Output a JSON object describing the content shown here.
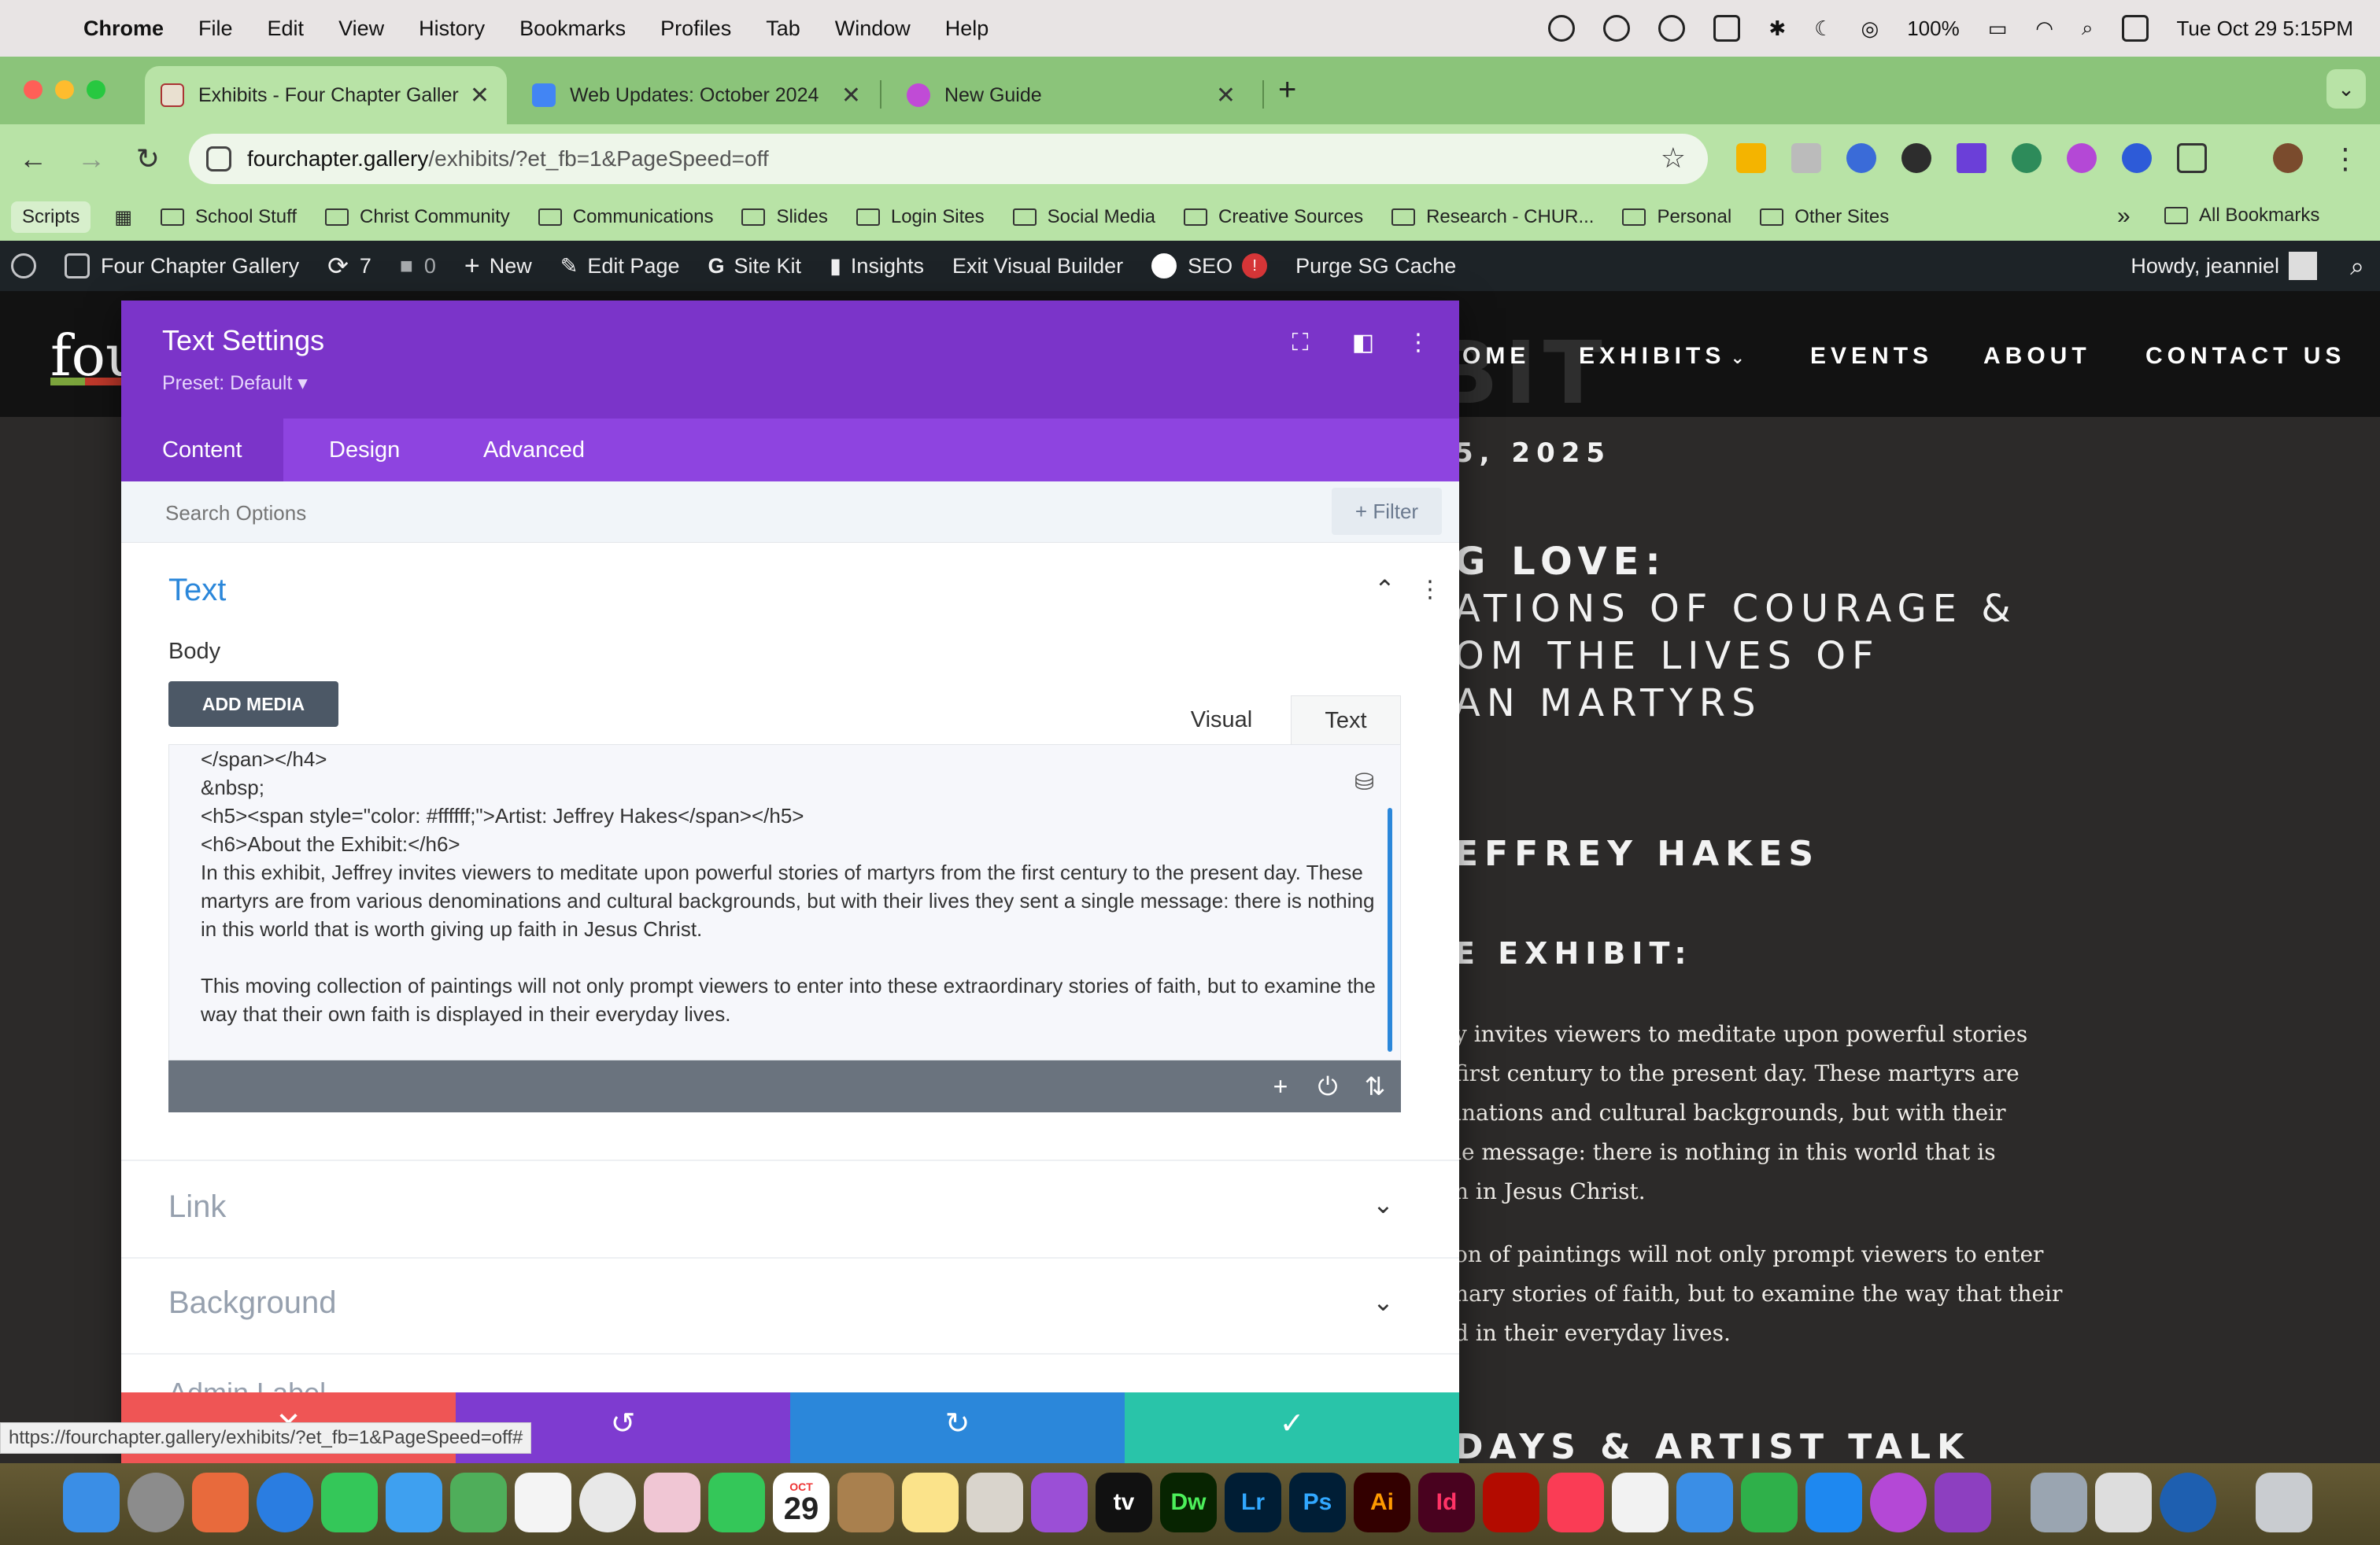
{
  "menubar": {
    "app": "Chrome",
    "items": [
      "File",
      "Edit",
      "View",
      "History",
      "Bookmarks",
      "Profiles",
      "Tab",
      "Window",
      "Help"
    ],
    "battery": "100%",
    "datetime": "Tue Oct 29  5:15PM"
  },
  "tabs": [
    {
      "title": "Exhibits - Four Chapter Galler",
      "active": true
    },
    {
      "title": "Web Updates: October 2024",
      "active": false
    },
    {
      "title": "New Guide",
      "active": false
    }
  ],
  "address": {
    "host": "fourchapter.gallery",
    "path": "/exhibits/?et_fb=1&PageSpeed=off"
  },
  "bookmarks": {
    "scripts": "Scripts",
    "folders": [
      "School Stuff",
      "Christ Community",
      "Communications",
      "Slides",
      "Login Sites",
      "Social Media",
      "Creative Sources",
      "Research - CHUR...",
      "Personal",
      "Other Sites"
    ],
    "more": "»",
    "all": "All Bookmarks"
  },
  "wpbar": {
    "site": "Four Chapter Gallery",
    "updates": "7",
    "comments": "0",
    "new": "New",
    "edit": "Edit Page",
    "sitekit": "Site Kit",
    "insights": "Insights",
    "exit": "Exit Visual Builder",
    "seo": "SEO",
    "seo_badge": "!",
    "purge": "Purge SG Cache",
    "howdy": "Howdy, jeanniel"
  },
  "site": {
    "logo": "fou",
    "nav": [
      "OME",
      "EXHIBITS",
      "EVENTS",
      "ABOUT",
      "CONTACT US"
    ],
    "bg_word": "BIT",
    "date": "5, 2025",
    "heading_lines": [
      "G LOVE:",
      "ATIONS OF COURAGE &",
      "OM THE LIVES OF",
      "AN MARTYRS"
    ],
    "artist": "EFFREY HAKES",
    "about": "E EXHIBIT:",
    "para1": [
      "y invites viewers to meditate upon powerful stories",
      "first century to the present day. These martyrs are",
      "inations and cultural backgrounds, but with their",
      "le message: there is nothing in this world that is",
      "h in Jesus Christ."
    ],
    "para2": [
      "on of paintings will not only prompt viewers to enter",
      "nary stories of faith, but to examine the way that their",
      "d in their everyday lives."
    ],
    "bottom": "DAYS & ARTIST TALK"
  },
  "modal": {
    "title": "Text Settings",
    "preset": "Preset: Default ▾",
    "tabs": [
      "Content",
      "Design",
      "Advanced"
    ],
    "search_placeholder": "Search Options",
    "filter": "+ Filter",
    "section_text": "Text",
    "body_label": "Body",
    "add_media": "ADD MEDIA",
    "editor_tabs": [
      "Visual",
      "Text"
    ],
    "code": "</span></h4>\n&nbsp;\n<h5><span style=\"color: #ffffff;\">Artist: Jeffrey Hakes</span></h5>\n<h6>About the Exhibit:</h6>\nIn this exhibit, Jeffrey invites viewers to meditate upon powerful stories of martyrs from the first century to the present day. These martyrs are from various denominations and cultural backgrounds, but with their lives they sent a single message: there is nothing in this world that is worth giving up faith in Jesus Christ.\n\nThis moving collection of paintings will not only prompt viewers to enter into these extraordinary stories of faith, but to examine the way that their own faith is displayed in their everyday lives.",
    "section_link": "Link",
    "section_background": "Background",
    "section_admin": "Admin Label"
  },
  "status_url": "https://fourchapter.gallery/exhibits/?et_fb=1&PageSpeed=off#",
  "dock": {
    "calendar_month": "OCT",
    "calendar_day": "29",
    "apps": [
      "tv",
      "Dw",
      "Lr",
      "Ps",
      "Ai",
      "Id"
    ]
  },
  "colors": {
    "divi_purple": "#7b34c9",
    "divi_tab_purple": "#8e44e0",
    "cancel_red": "#ef5555",
    "undo_purple": "#7e3bd0",
    "redo_blue": "#2b87da",
    "save_green": "#29c4a9",
    "chrome_green": "#8bc47a"
  }
}
